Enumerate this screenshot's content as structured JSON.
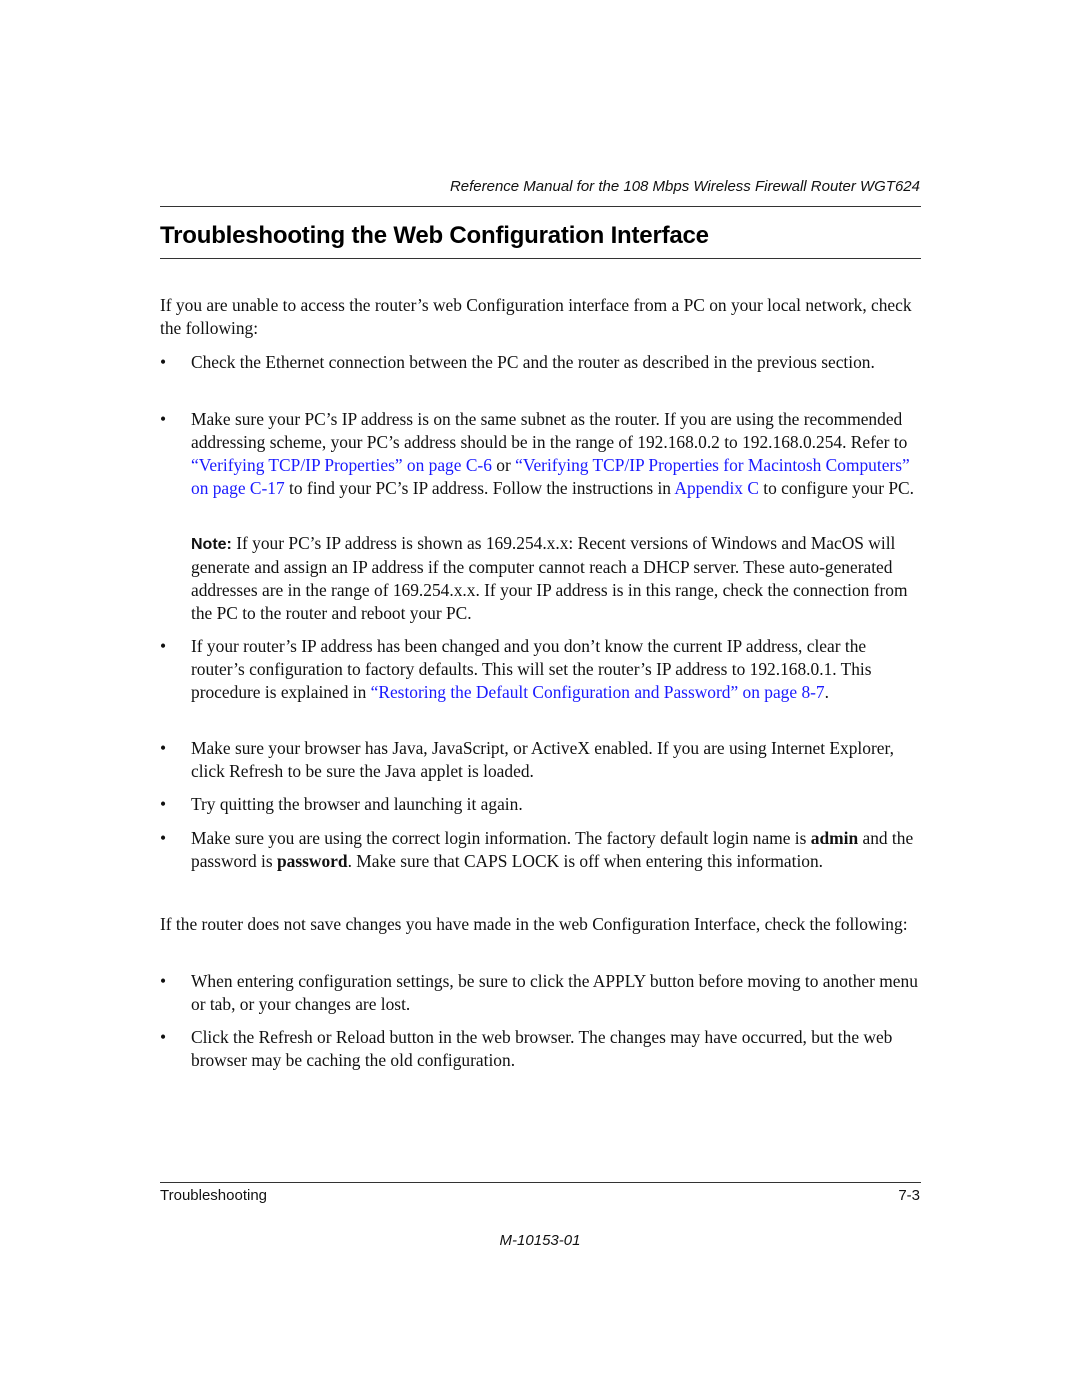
{
  "header": {
    "running_title": "Reference Manual for the 108 Mbps Wireless Firewall Router WGT624"
  },
  "section": {
    "title": "Troubleshooting the Web Configuration Interface"
  },
  "content": {
    "intro": "If you are unable to access the router’s web Configuration interface from a PC on your local network, check the following:",
    "bullet_char": "•",
    "bullet1": "Check the Ethernet connection between the PC and the router as described in the previous section.",
    "bullet2": {
      "part1": "Make sure your PC’s IP address is on the same subnet as the router. If you are using the recommended addressing scheme, your PC’s address should be in the range of 192.168.0.2 to 192.168.0.254. Refer to ",
      "link1": "“Verifying TCP/IP Properties” on page C-6",
      "part2": " or ",
      "link2": "“Verifying TCP/IP Properties for Macintosh Computers” on page C-17",
      "part3": " to find your PC’s IP address. Follow the instructions in ",
      "link3": "Appendix C",
      "part4": " to configure your PC."
    },
    "note": {
      "label": "Note:",
      "text": " If your PC’s IP address is shown as 169.254.x.x: Recent versions of Windows and MacOS will generate and assign an IP address if the computer cannot reach a DHCP server. These auto-generated addresses are in the range of 169.254.x.x. If your IP address is in this range, check the connection from the PC to the router and reboot your PC."
    },
    "bullet3": {
      "part1": "If your router’s IP address has been changed and you don’t know the current IP address, clear the router’s configuration to factory defaults. This will set the router’s IP address to 192.168.0.1. This procedure is explained in ",
      "link1": "“Restoring the Default Configuration and Password” on page 8-7",
      "part2": "."
    },
    "bullet4": "Make sure your browser has Java, JavaScript, or ActiveX enabled. If you are using Internet Explorer, click Refresh to be sure the Java applet is loaded.",
    "bullet5": "Try quitting the browser and launching it again.",
    "bullet6": {
      "part1": "Make sure you are using the correct login information. The factory default login name is ",
      "bold1": "admin",
      "part2": " and the password is ",
      "bold2": "password",
      "part3": ". Make sure that CAPS LOCK is off when entering this information."
    },
    "para2": "If the router does not save changes you have made in the web Configuration Interface, check the following:",
    "bullet7": "When entering configuration settings, be sure to click the APPLY button before moving to another menu or tab, or your changes are lost.",
    "bullet8": "Click the Refresh or Reload button in the web browser. The changes may have occurred, but the web browser may be caching the old configuration."
  },
  "footer": {
    "chapter": "Troubleshooting",
    "page_number": "7-3",
    "doc_number": "M-10153-01"
  },
  "colors": {
    "link": "#1a1aff",
    "text": "#111111"
  }
}
